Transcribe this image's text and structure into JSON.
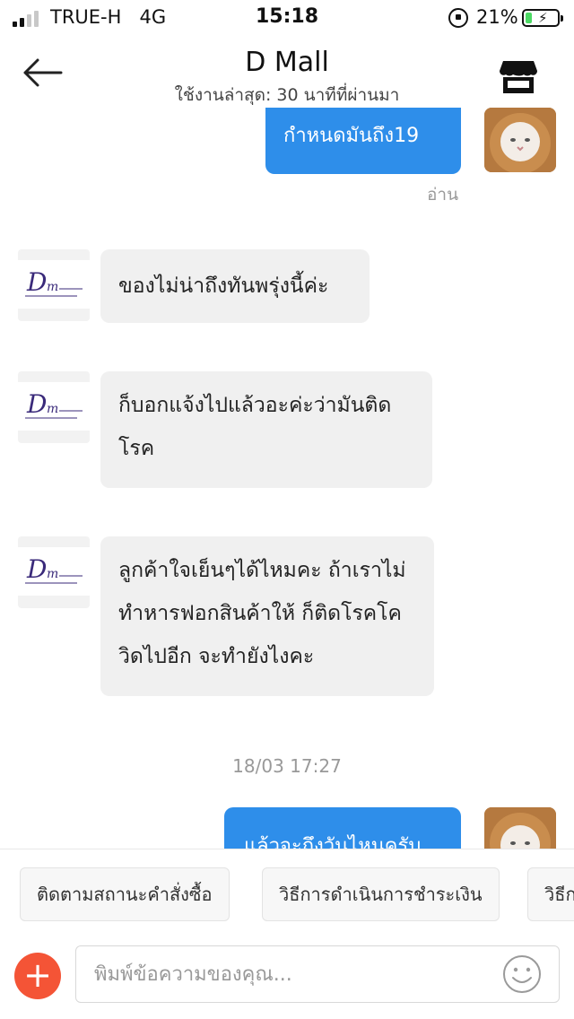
{
  "status_bar": {
    "carrier": "TRUE-H",
    "network": "4G",
    "time": "15:18",
    "battery_percent": "21%",
    "battery_level": 0.21,
    "battery_color": "#4cd964",
    "signal_bars": 2
  },
  "header": {
    "title": "D Mall",
    "subtitle": "ใช้งานล่าสุด: 30 นาทีที่ผ่านมา",
    "back_icon": "back-arrow-icon",
    "store_icon": "store-icon"
  },
  "chat": {
    "messages": [
      {
        "sender": "user",
        "text": "กำหนดมันถึง19",
        "status": "อ่าน"
      },
      {
        "sender": "shop",
        "lines": [
          "ของไม่น่าถึงทันพรุ่งนี้ค่ะ"
        ]
      },
      {
        "sender": "shop",
        "lines": [
          "ก็บอกแจ้งไปแล้วอะค่ะว่ามันติด",
          "โรค"
        ]
      },
      {
        "sender": "shop",
        "lines": [
          "ลูกค้าใจเย็นๆได้ไหมคะ ถ้าเราไม่",
          "ทำหารฟอกสินค้าให้ ก็ติดโรคโค",
          "วิดไปอีก จะทำยังไงคะ"
        ]
      },
      {
        "sender": "user",
        "text": "แล้วจะถึงวันไหนครับ"
      }
    ],
    "time_separator": "18/03 17:27"
  },
  "quick_replies": [
    "ติดตามสถานะคำสั่งซื้อ",
    "วิธีการดำเนินการชำระเงิน",
    "วิธีก"
  ],
  "input": {
    "placeholder": "พิมพ์ข้อความของคุณ...",
    "plus_label": "+"
  },
  "colors": {
    "outgoing_bubble": "#2e8eea",
    "incoming_bubble": "#f0f0f0",
    "plus_button": "#f45436"
  }
}
